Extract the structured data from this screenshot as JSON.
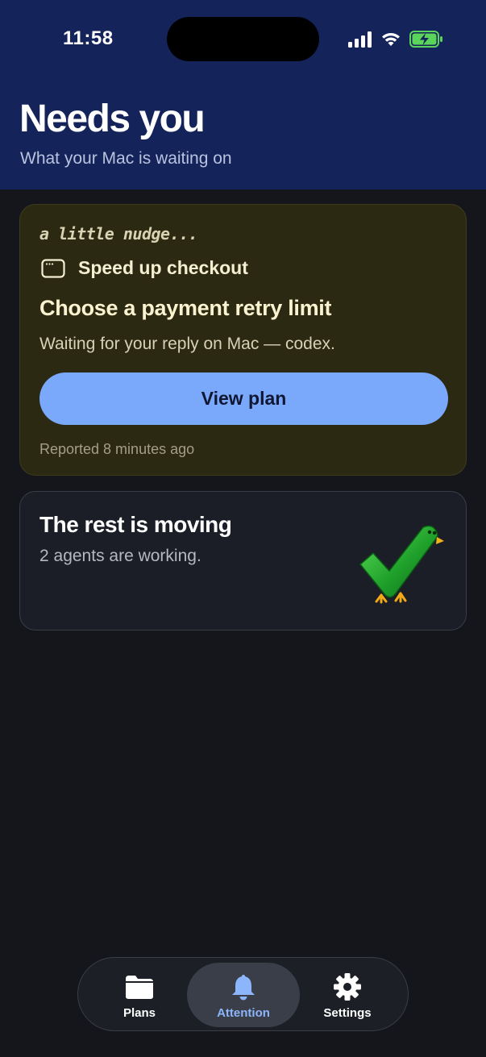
{
  "status_bar": {
    "time": "11:58"
  },
  "header": {
    "title": "Needs you",
    "subtitle": "What your Mac is waiting on"
  },
  "nudge_card": {
    "kicker": "a little nudge...",
    "plan_icon": "window-icon",
    "plan_name": "Speed up checkout",
    "question": "Choose a payment retry limit",
    "waiting_text": "Waiting for your reply on Mac — codex.",
    "button_label": "View plan",
    "reported": "Reported 8 minutes ago"
  },
  "rest_card": {
    "title": "The rest is moving",
    "subtitle": "2 agents are working.",
    "mascot_icon": "checkmark-bird-icon"
  },
  "tab_bar": {
    "selected": "Attention",
    "tabs": [
      {
        "label": "Plans",
        "icon": "folder-icon"
      },
      {
        "label": "Attention",
        "icon": "bell-icon"
      },
      {
        "label": "Settings",
        "icon": "gear-icon"
      }
    ]
  },
  "colors": {
    "header_bg": "#14245a",
    "page_bg": "#14161c",
    "nudge_bg": "#2c2913",
    "accent": "#7aa8fa",
    "active_tab_label": "#8cb5fb",
    "battery_green": "#5ad45a"
  }
}
